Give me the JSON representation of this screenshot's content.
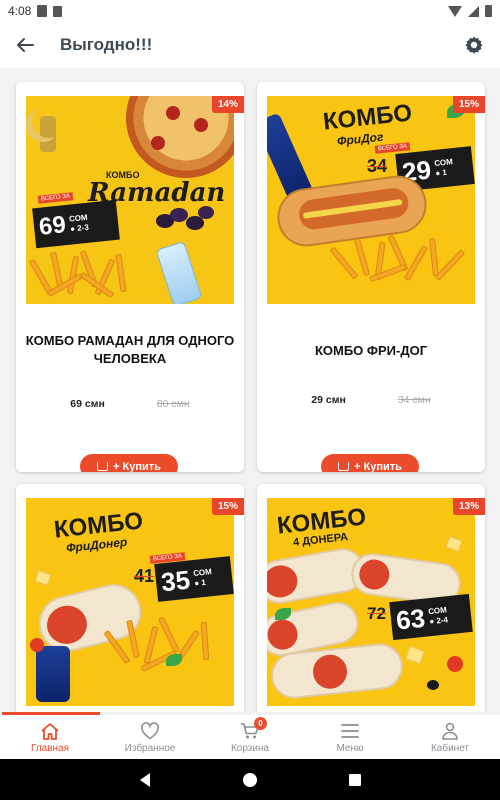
{
  "status_bar": {
    "time": "4:08"
  },
  "app_bar": {
    "title": "Выгодно!!!"
  },
  "products": [
    {
      "name": "КОМБО РАМАДАН ДЛЯ ОДНОГО ЧЕЛОВЕКА",
      "discount": "14%",
      "price": "69 смн",
      "old_price": "80 смн",
      "buy_label": "+ Купить",
      "promo": {
        "headline": "Ramadan",
        "small": "КОМБО",
        "tag_price": "69",
        "currency": "СОМ",
        "persons": "2-3",
        "tag_top": "ВСЕГО ЗА"
      }
    },
    {
      "name": "КОМБО ФРИ-ДОГ",
      "discount": "15%",
      "price": "29 смн",
      "old_price": "34 смн",
      "buy_label": "+ Купить",
      "promo": {
        "headline": "КОМБО",
        "small": "ФриДог",
        "tag_price": "29",
        "currency": "СОМ",
        "persons": "1",
        "tag_old": "34",
        "tag_top": "ВСЕГО ЗА"
      }
    },
    {
      "name": "",
      "discount": "15%",
      "promo": {
        "headline": "КОМБО",
        "small": "ФриДонер",
        "tag_price": "35",
        "currency": "СОМ",
        "persons": "1",
        "tag_old": "41",
        "tag_top": "ВСЕГО ЗА"
      }
    },
    {
      "name": "",
      "discount": "13%",
      "promo": {
        "headline": "КОМБО",
        "small": "4 ДОНЕРА",
        "tag_price": "63",
        "currency": "СОМ",
        "persons": "2-4",
        "tag_old": "72"
      }
    }
  ],
  "bottom_nav": {
    "items": [
      {
        "label": "Главная",
        "icon": "home-icon"
      },
      {
        "label": "Избранное",
        "icon": "heart-icon"
      },
      {
        "label": "Корзина",
        "icon": "cart-icon",
        "badge": "0"
      },
      {
        "label": "Меню",
        "icon": "menu-icon"
      },
      {
        "label": "Кабинет",
        "icon": "person-icon"
      }
    ]
  },
  "colors": {
    "accent": "#ec4c2c",
    "promo_yellow": "#f8c81a",
    "title_text": "#3c4a55"
  }
}
